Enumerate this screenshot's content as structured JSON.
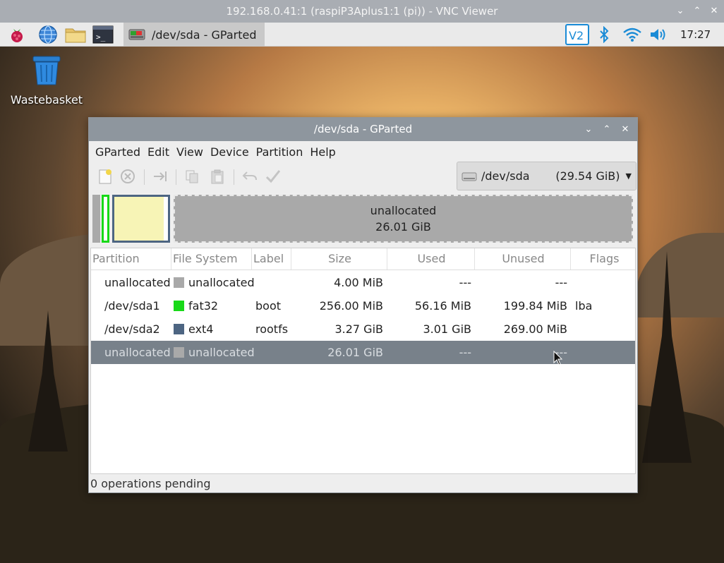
{
  "vnc": {
    "title": "192.168.0.41:1 (raspiP3Aplus1:1 (pi)) - VNC Viewer"
  },
  "panel": {
    "task_title": "/dev/sda - GParted",
    "clock": "17:27"
  },
  "desktop": {
    "wastebasket_label": "Wastebasket"
  },
  "window": {
    "title": "/dev/sda - GParted",
    "menu": [
      "GParted",
      "Edit",
      "View",
      "Device",
      "Partition",
      "Help"
    ],
    "device": {
      "name": "/dev/sda",
      "size": "(29.54 GiB)"
    }
  },
  "graph": {
    "unallocated_label": "unallocated",
    "unallocated_size": "26.01 GiB"
  },
  "table": {
    "headers": [
      "Partition",
      "File System",
      "Label",
      "Size",
      "Used",
      "Unused",
      "Flags"
    ],
    "rows": [
      {
        "partition": "unallocated",
        "fs": "unallocated",
        "fs_color": "#a9a9a9",
        "label": "",
        "size": "4.00 MiB",
        "used": "---",
        "unused": "---",
        "flags": ""
      },
      {
        "partition": "/dev/sda1",
        "fs": "fat32",
        "fs_color": "#18d918",
        "label": "boot",
        "size": "256.00 MiB",
        "used": "56.16 MiB",
        "unused": "199.84 MiB",
        "flags": "lba"
      },
      {
        "partition": "/dev/sda2",
        "fs": "ext4",
        "fs_color": "#4d6582",
        "label": "rootfs",
        "size": "3.27 GiB",
        "used": "3.01 GiB",
        "unused": "269.00 MiB",
        "flags": ""
      },
      {
        "partition": "unallocated",
        "fs": "unallocated",
        "fs_color": "#a9a9a9",
        "label": "",
        "size": "26.01 GiB",
        "used": "---",
        "unused": "---",
        "flags": ""
      }
    ],
    "selected_row": 3
  },
  "status": {
    "text": "0 operations pending"
  },
  "colors": {
    "selection": "#78818a",
    "titlebar": "#8e969e",
    "unallocated": "#a9a9a9"
  }
}
